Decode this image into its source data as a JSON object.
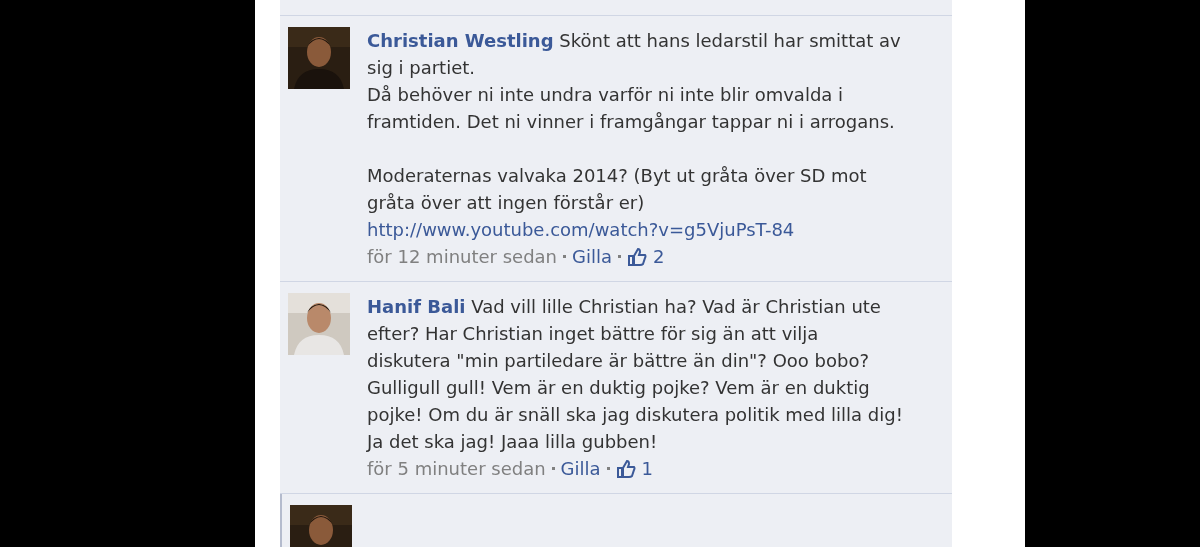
{
  "comments": [
    {
      "author": "Christian Westling",
      "text": "Skönt att hans ledarstil har smittat av sig i partiet.\nDå behöver ni inte undra varför ni inte blir omvalda i framtiden. Det ni vinner i framgångar tappar ni i arrogans.\n\nModeraternas valvaka 2014? (Byt ut gråta över SD mot gråta över att ingen förstår er)",
      "link": "http://www.youtube.com/watch?v=g5VjuPsT-84",
      "time": "för 12 minuter sedan",
      "like_label": "Gilla",
      "likes": "2"
    },
    {
      "author": "Hanif Bali",
      "text": "Vad vill lille Christian ha? Vad är Christian ute efter? Har Christian inget bättre för sig än att vilja diskutera \"min partiledare är bättre än din\"? Ooo bobo? Gulligull gull! Vem är en duktig pojke? Vem är en duktig pojke! Om du är snäll ska jag diskutera politik med lilla dig! Ja det ska jag! Jaaa lilla gubben!",
      "time": "för 5 minuter sedan",
      "like_label": "Gilla",
      "likes": "1"
    }
  ]
}
